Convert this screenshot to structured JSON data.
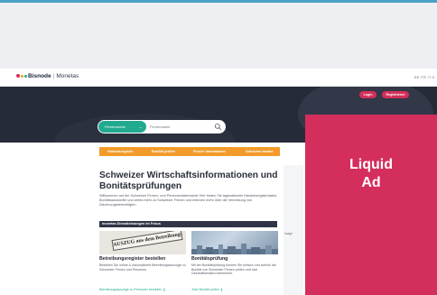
{
  "header": {
    "brand": "Bisnode",
    "product": "Monetas",
    "languages": "DE FR IT E",
    "brand_dot_colors": [
      "#d32f5a",
      "#f39b2a",
      "#22aa91"
    ]
  },
  "hero": {
    "login_label": "Login",
    "register_label": "Registrieren",
    "search": {
      "type_label": "Firmensuche",
      "placeholder": "Firmenname"
    }
  },
  "nav": {
    "items": [
      "Handelsregister",
      "Bonität prüfen",
      "Firmen überwachen",
      "Adressen kaufen"
    ]
  },
  "main": {
    "headline": "Schweizer Wirtschaftsinformationen und Bonitätsprüfungen",
    "intro": "Willkommen auf der Schweizer Firmen- und Personendatenbank! Hier finden Sie tagesaktuelle Handelsregisterdaten, Bonitätsauskünfte und vieles mehr zu Schweizer Firmen und erfahren mehr über die Vernetzung von Zeichnungsberechtigten.",
    "section_title": "monetas Dienstleistungen im Fokus",
    "cards": [
      {
        "image_text": "AUSZUG aus dem Betreibungsregister",
        "title": "Betreibungsregister bestellen",
        "text": "Bestellen Sie online & unkompliziert Betreibungsauszüge zu Schweizer Firmen und Personen.",
        "link": "Betreibungsauszüge zu Personen bestellen ❯"
      },
      {
        "title": "Bonitätsprüfung",
        "text": "Mit der Bonitätsprüfung können Sie einfach und schnell die Bonität von Schweizer Firmen prüfen und sich Geschäftsrisiken minimieren.",
        "link": "Jetzt Bonität prüfen ❯"
      }
    ]
  },
  "sidebar": {
    "label": "Image"
  },
  "ad": {
    "line1": "Liquid",
    "line2": "Ad",
    "color": "#d42e5d"
  },
  "colors": {
    "accent_green": "#22aa91",
    "nav_orange": "#f39b2a",
    "hero_dark": "#262b3a",
    "brand_pink": "#d32f5a"
  }
}
